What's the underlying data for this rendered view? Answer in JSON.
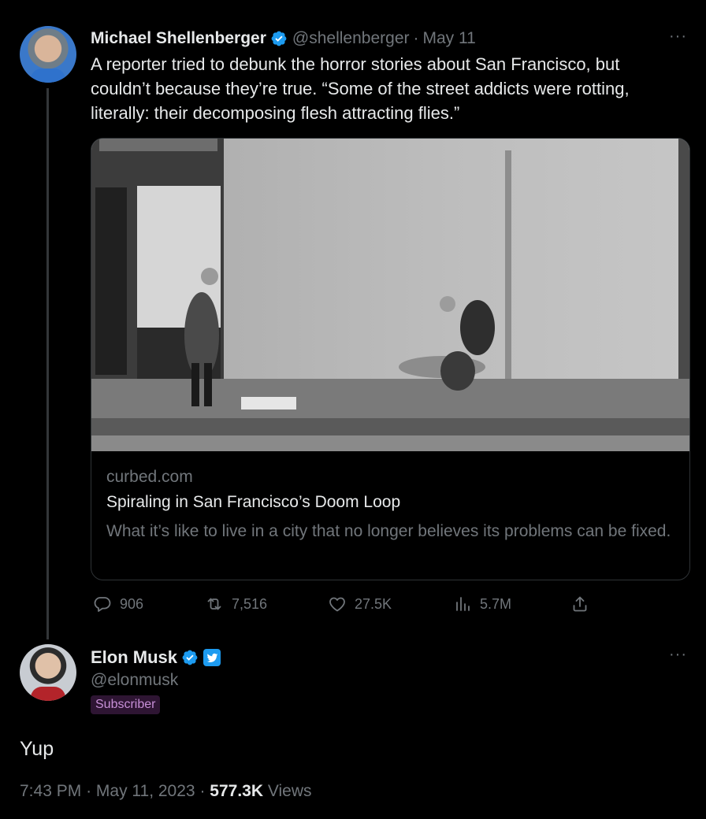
{
  "parent_tweet": {
    "author_name": "Michael Shellenberger",
    "handle": "@shellenberger",
    "separator": "·",
    "date": "May 11",
    "more": "···",
    "text": "A reporter tried to debunk the horror stories about San Francisco, but couldn’t because they’re true. “Some of the street addicts were rotting, literally: their decomposing flesh attracting flies.”",
    "card": {
      "domain": "curbed.com",
      "title": "Spiraling in San Francisco’s Doom Loop",
      "description": "What it’s like to live in a city that no longer believes its problems can be fixed."
    },
    "actions": {
      "replies": "906",
      "retweets": "7,516",
      "likes": "27.5K",
      "views": "5.7M"
    }
  },
  "reply_tweet": {
    "author_name": "Elon Musk",
    "handle": "@elonmusk",
    "badge": "Subscriber",
    "more": "···",
    "text": "Yup",
    "time": "7:43 PM",
    "separator": "·",
    "date": "May 11, 2023",
    "views_count": "577.3K",
    "views_label": "Views"
  },
  "colors": {
    "background": "#000000",
    "text_primary": "#e7e9ea",
    "text_secondary": "#71767b",
    "verified_blue": "#1d9bf0",
    "subscriber_bg": "#2e1533",
    "subscriber_text": "#c78fd7"
  },
  "icons": [
    "verified-icon",
    "more-icon",
    "reply-icon",
    "retweet-icon",
    "like-icon",
    "views-icon",
    "share-icon",
    "twitter-badge-icon"
  ]
}
